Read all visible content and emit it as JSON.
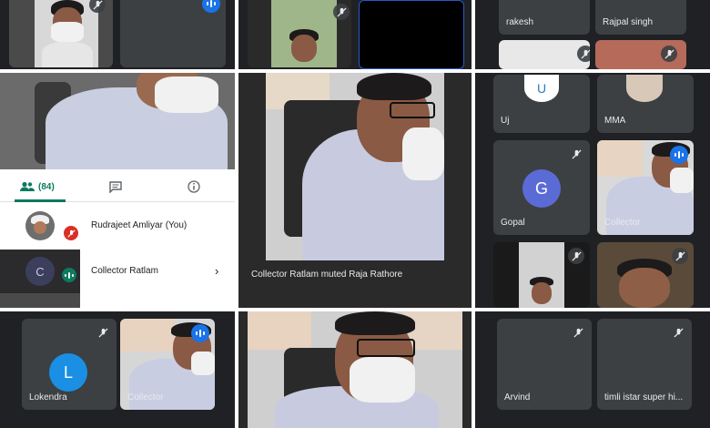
{
  "participants_tab": {
    "count_label": "(84)",
    "people_icon": "people-icon",
    "chat_icon": "chat-icon",
    "info_icon": "info-icon"
  },
  "participants": [
    {
      "name": "Rudrajeet Amliyar (You)",
      "mic": "muted"
    },
    {
      "name": "Collector Ratlam",
      "mic": "speaking",
      "avatar_letter": "C"
    }
  ],
  "toast_message": "Collector Ratlam muted Raja Rathore",
  "tiles": {
    "rakesh": "rakesh",
    "rajpal": "Rajpal singh",
    "uj": "Uj",
    "mma": "MMA",
    "gopal": {
      "name": "Gopal",
      "letter": "G"
    },
    "collector_right": "Collector",
    "lokendra": {
      "name": "Lokendra",
      "letter": "L"
    },
    "collector_bottom": "Collector",
    "arvind": "Arvind",
    "timli": "timli istar super hi..."
  },
  "colors": {
    "panel_bg": "#202124",
    "tile_bg": "#3c4043",
    "accent_green": "#0d7a5f",
    "speaking_blue": "#1a73e8",
    "gopal_avatar": "#5b6bd6",
    "lokendra_avatar": "#1a8fe3",
    "collector_avatar": "#3b3f5c",
    "muted_red": "#d93025"
  }
}
